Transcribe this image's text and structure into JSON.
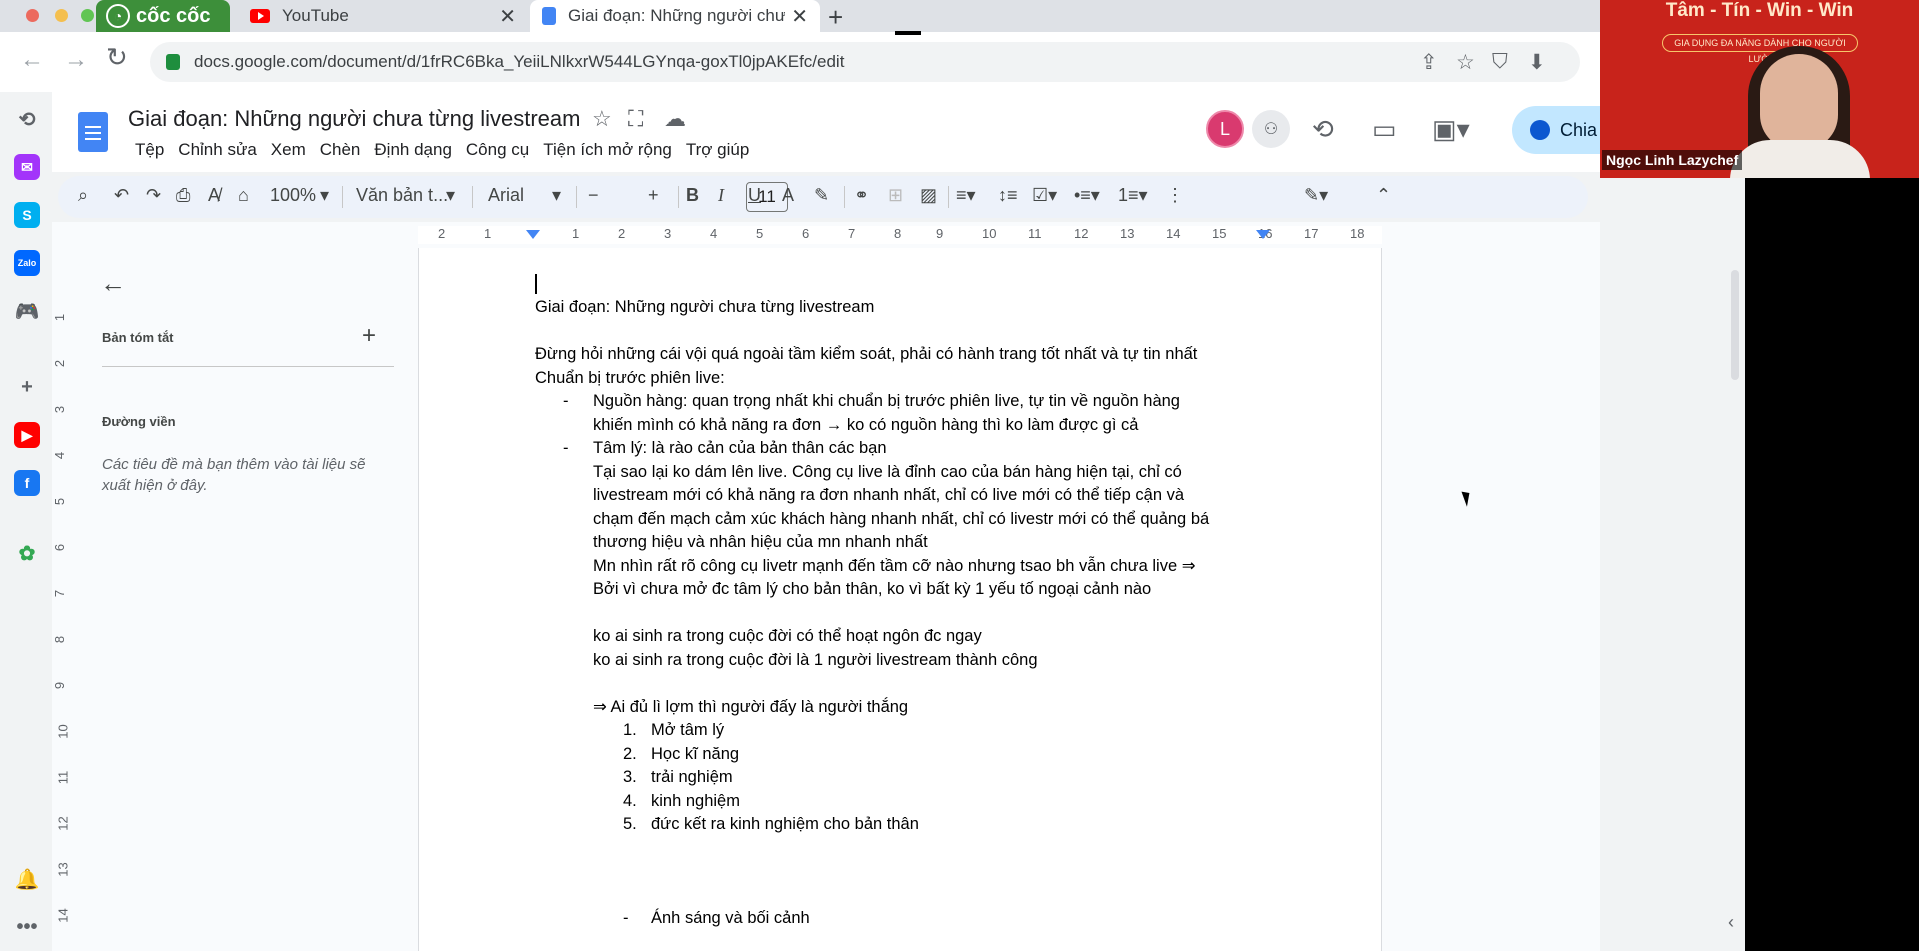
{
  "browser": {
    "coccoc_label": "cốc cốc",
    "tabs": [
      {
        "label": "YouTube"
      },
      {
        "label": "Giai đoạn: Những người chưa từng livestream"
      }
    ],
    "url": "docs.google.com/document/d/1frRC6Bka_YeiiLNlkxrW544LGYnqa-goxTl0jpAKEfc/edit"
  },
  "sidebar_icons": [
    {
      "name": "history-icon",
      "glyph": "⟲",
      "color": "#5f6368"
    },
    {
      "name": "messenger-icon",
      "glyph": "✉",
      "color": "#a334fa"
    },
    {
      "name": "skype-icon",
      "glyph": "S",
      "color": "#00aff0"
    },
    {
      "name": "zalo-icon",
      "glyph": "Zalo",
      "color": "#0068ff"
    },
    {
      "name": "game-icon",
      "glyph": "🎮",
      "color": "#2e9e4f"
    },
    {
      "name": "add-icon",
      "glyph": "+",
      "color": "#5f6368"
    },
    {
      "name": "youtube-icon",
      "glyph": "▶",
      "color": "#ff0000"
    },
    {
      "name": "facebook-icon",
      "glyph": "f",
      "color": "#1877f2"
    },
    {
      "name": "extension-icon",
      "glyph": "✿",
      "color": "#34a853"
    },
    {
      "name": "bell-icon",
      "glyph": "🔔",
      "color": "#5f6368"
    },
    {
      "name": "more-icon",
      "glyph": "•••",
      "color": "#5f6368"
    }
  ],
  "docs": {
    "title": "Giai đoạn: Những người chưa từng livestream",
    "menu": [
      "Tệp",
      "Chỉnh sửa",
      "Xem",
      "Chèn",
      "Định dạng",
      "Công cụ",
      "Tiện ích mở rộng",
      "Trợ giúp"
    ],
    "avatar_letter": "L",
    "share_label": "Chia",
    "toolbar": {
      "zoom": "100%",
      "style": "Văn bản t...",
      "font": "Arial",
      "font_size": "11"
    },
    "ruler_ticks": [
      "2",
      "1",
      "1",
      "2",
      "3",
      "4",
      "5",
      "6",
      "7",
      "8",
      "9",
      "10",
      "11",
      "12",
      "13",
      "14",
      "15",
      "16",
      "17",
      "18"
    ],
    "vruler_ticks": [
      "1",
      "2",
      "3",
      "4",
      "5",
      "6",
      "7",
      "8",
      "9",
      "10",
      "11",
      "12",
      "13",
      "14"
    ],
    "outline": {
      "summary_label": "Bản tóm tắt",
      "outline_label": "Đường viền",
      "hint": "Các tiêu đề mà bạn thêm vào tài liệu sẽ xuất hiện ở đây."
    },
    "content": {
      "heading": "Giai đoạn: Những người chưa từng livestream",
      "intro": "Đừng hỏi những cái vội quá ngoài tầm kiểm soát, phải có hành trang tốt nhất và tự tin nhất",
      "prep": "Chuẩn bị trước phiên live:",
      "bullet_mark": "-",
      "b1_l1": "Nguồn hàng: quan trọng nhất khi chuẩn bị trước phiên live, tự tin về nguồn hàng",
      "b1_l2": "khiến mình có khả năng ra đơn → ko có nguồn hàng thì ko làm được gì cả",
      "b2": "Tâm lý: là rào cản của bản thân các bạn",
      "p1": "Tại sao lại ko dám lên live. Công cụ live là đỉnh cao của bán hàng hiện tại, chỉ có",
      "p2": "livestream mới có khả năng ra đơn nhanh nhất, chỉ có live mới có thể tiếp cận và",
      "p3": "chạm đến mạch cảm xúc khách hàng nhanh nhất, chỉ có livestr mới có thể quảng bá",
      "p4": "thương hiệu và nhân hiệu của mn nhanh nhất",
      "p5": "Mn nhìn rất rõ công cụ livetr mạnh đến tầm cỡ nào nhưng tsao bh vẫn chưa live ⇒",
      "p6": "Bởi vì chưa mở đc tâm lý cho bản thân, ko vì bất kỳ 1 yếu tố ngoại cảnh nào",
      "p7": "ko ai sinh ra trong cuộc đời có thể hoạt ngôn đc ngay",
      "p8": "ko ai sinh ra trong cuộc đời là 1 người livestream thành công",
      "p9": "⇒ Ai đủ lì lợm thì người đấy là người thắng",
      "numbered": [
        {
          "n": "1.",
          "t": "Mở tâm lý"
        },
        {
          "n": "2.",
          "t": "Học kĩ năng"
        },
        {
          "n": "3.",
          "t": "trải nghiệm"
        },
        {
          "n": "4.",
          "t": "kinh nghiệm"
        },
        {
          "n": "5.",
          "t": "đức kết ra kinh nghiệm cho bản thân"
        }
      ],
      "b3": "Ánh sáng và bối cảnh"
    }
  },
  "webcam": {
    "banner": "Tâm - Tín - Win - Win",
    "slogan": "GIA DỤNG ĐA NĂNG DÀNH CHO NGƯỜI LƯỜI",
    "name": "Ngọc Linh Lazychef"
  },
  "colors": {
    "docs_blue": "#4285f4",
    "share_bg": "#c2e7ff",
    "webcam_red": "#c8231b"
  }
}
